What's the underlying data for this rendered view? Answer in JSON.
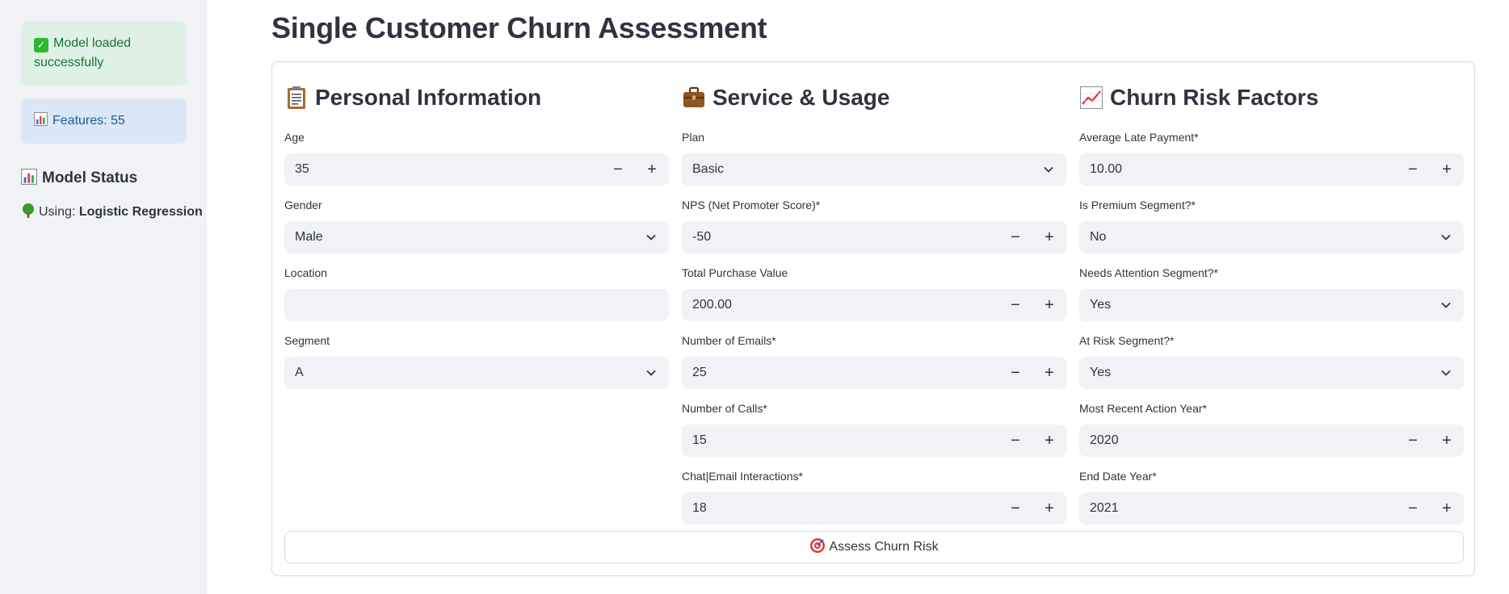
{
  "sidebar": {
    "success_message": "Model loaded successfully",
    "info_message": "Features: 55",
    "status_title": "Model Status",
    "using_label": "Using:",
    "model_name": "Logistic Regression"
  },
  "page": {
    "title": "Single Customer Churn Assessment"
  },
  "personal": {
    "heading": "Personal Information",
    "age": {
      "label": "Age",
      "value": "35"
    },
    "gender": {
      "label": "Gender",
      "value": "Male"
    },
    "location": {
      "label": "Location",
      "value": ""
    },
    "segment": {
      "label": "Segment",
      "value": "A"
    }
  },
  "service": {
    "heading": "Service & Usage",
    "plan": {
      "label": "Plan",
      "value": "Basic"
    },
    "nps": {
      "label": "NPS (Net Promoter Score)*",
      "value": "-50"
    },
    "total_purchase": {
      "label": "Total Purchase Value",
      "value": "200.00"
    },
    "emails": {
      "label": "Number of Emails*",
      "value": "25"
    },
    "calls": {
      "label": "Number of Calls*",
      "value": "15"
    },
    "chat": {
      "label": "Chat|Email Interactions*",
      "value": "18"
    }
  },
  "risk": {
    "heading": "Churn Risk Factors",
    "late_payment": {
      "label": "Average Late Payment*",
      "value": "10.00"
    },
    "premium": {
      "label": "Is Premium Segment?*",
      "value": "No"
    },
    "attention": {
      "label": "Needs Attention Segment?*",
      "value": "Yes"
    },
    "at_risk": {
      "label": "At Risk Segment?*",
      "value": "Yes"
    },
    "recent_year": {
      "label": "Most Recent Action Year*",
      "value": "2020"
    },
    "end_year": {
      "label": "End Date Year*",
      "value": "2021"
    }
  },
  "stepper": {
    "minus": "−",
    "plus": "+"
  },
  "assess_button": "Assess Churn Risk",
  "icons": {
    "success": "check-mark-icon",
    "info": "bar-chart-icon",
    "status": "bar-chart-icon",
    "model": "tree-icon",
    "personal": "clipboard-icon",
    "service": "briefcase-icon",
    "risk": "chart-increasing-icon",
    "assess": "target-icon"
  }
}
